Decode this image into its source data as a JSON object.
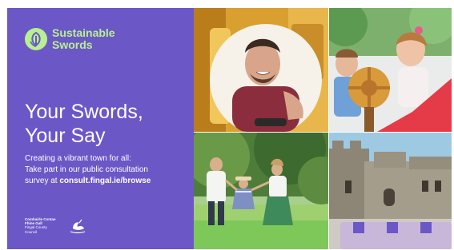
{
  "brand": {
    "line1": "Sustainable",
    "line2": "Swords",
    "icon": "leaf-pen-icon"
  },
  "headline": {
    "line1": "Your Swords,",
    "line2": "Your Say"
  },
  "subtext": {
    "line1": "Creating a vibrant town for all:",
    "line2": "Take part in our public consultation",
    "line3_prefix": "survey at ",
    "link": "consult.fingal.ie/browse"
  },
  "council": {
    "line1": "Comhairle Contae",
    "line2": "Fhine Gall",
    "line3": "Fingal County",
    "line4": "Council",
    "logo": "fingal-swan-logo"
  },
  "colors": {
    "panel": "#6b58c6",
    "accent": "#b8f08f",
    "text": "#ffffff"
  },
  "photos": [
    {
      "name": "photo-man-smiling"
    },
    {
      "name": "photo-children-playground"
    },
    {
      "name": "photo-family-walking"
    },
    {
      "name": "photo-swords-castle"
    }
  ]
}
